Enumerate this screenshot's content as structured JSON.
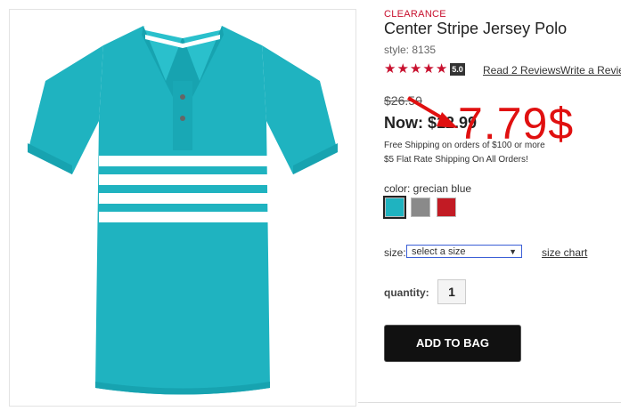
{
  "product": {
    "badge": "CLEARANCE",
    "title": "Center Stripe Jersey Polo",
    "style": "style: 8135",
    "rating": {
      "stars": 5,
      "value": "5.0"
    },
    "reviews_link": "Read 2 Reviews",
    "write_review_link": "Write a Review",
    "old_price": "$26.50",
    "now_price": "Now: $12.99",
    "shipping_line1": "Free Shipping on orders of $100 or more",
    "shipping_line2": "$5 Flat Rate Shipping On All Orders!",
    "annotation": "7.79$",
    "color_label": "color: grecian blue",
    "swatches": [
      {
        "name": "grecian blue",
        "color": "#1fb3c0",
        "selected": true
      },
      {
        "name": "gray",
        "color": "#8a8a8a",
        "selected": false
      },
      {
        "name": "red",
        "color": "#c21b24",
        "selected": false
      }
    ],
    "size_label": "size:",
    "size_select": "select a size",
    "size_chart_link": "size chart",
    "quantity_label": "quantity:",
    "quantity_value": "1",
    "add_to_bag": "ADD TO BAG",
    "image_colors": {
      "shirt": "#1fb3c0",
      "stripe": "#ffffff",
      "accent": "#e01010"
    }
  }
}
